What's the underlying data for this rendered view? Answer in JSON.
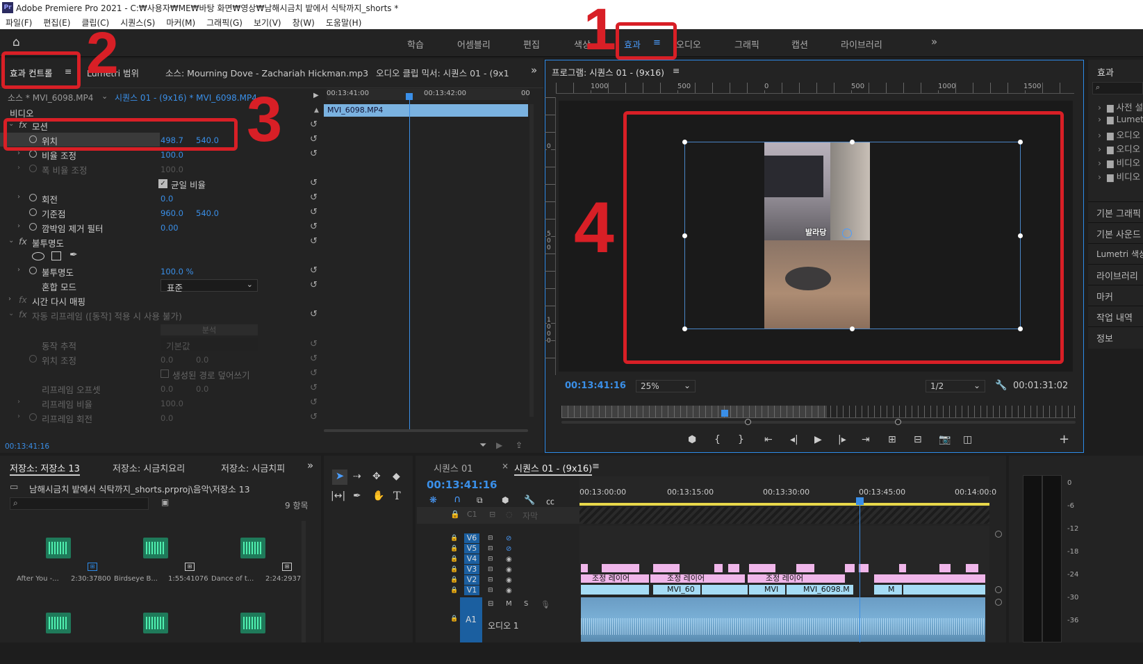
{
  "app": {
    "title": "Adobe Premiere Pro 2021 - C:₩사용자₩ME₩바탕 화면₩영상₩남해시금치 밭에서 식탁까지_shorts *",
    "logo": "Pr"
  },
  "menu": [
    "파일(F)",
    "편집(E)",
    "클립(C)",
    "시퀀스(S)",
    "마커(M)",
    "그래픽(G)",
    "보기(V)",
    "창(W)",
    "도움말(H)"
  ],
  "workspaces": [
    "학습",
    "어셈블리",
    "편집",
    "색상",
    "효과",
    "오디오",
    "그래픽",
    "캡션",
    "라이브러리"
  ],
  "workspace_active_menu": "≡",
  "workspace_more": "»",
  "left_panel": {
    "tabs": [
      "효과 컨트롤",
      "Lumetri 범위",
      "소스: Mourning Dove - Zachariah Hickman.mp3",
      "오디오 클립 믹서: 시퀀스 01 - (9x1"
    ],
    "tab_menu": "≡",
    "more": "»",
    "source": "소스 * MVI_6098.MP4",
    "sequence": "시퀀스 01 - (9x16) * MVI_6098.MP4",
    "section_video": "비디오",
    "tl_time1": "00:13:41:00",
    "tl_time2": "00:13:42:00",
    "tl_time3": "00",
    "clip_name": "MVI_6098.MP4",
    "motion": "모션",
    "position": {
      "label": "위치",
      "x": "498.7",
      "y": "540.0"
    },
    "scale": {
      "label": "비율 조정",
      "value": "100.0"
    },
    "scale_w": {
      "label": "폭 비율 조정",
      "value": "100.0"
    },
    "uniform": "균일 비율",
    "rotation": {
      "label": "회전",
      "value": "0.0"
    },
    "anchor": {
      "label": "기준점",
      "x": "960.0",
      "y": "540.0"
    },
    "antiflicker": {
      "label": "깜박임 제거 필터",
      "value": "0.00"
    },
    "opacity": "불투명도",
    "opacity_val": {
      "label": "불투명도",
      "value": "100.0 %"
    },
    "blend": {
      "label": "혼합 모드",
      "value": "표준"
    },
    "time_remap": "시간 다시 매핑",
    "auto_reframe": "자동 리프레임 ([동작] 적용 시 사용 불가)",
    "analyze": "분석",
    "motion_track": {
      "label": "동작 추적",
      "value": "기본값"
    },
    "pos_adjust": {
      "label": "위치 조정",
      "x": "0.0",
      "y": "0.0"
    },
    "overwrite": "생성된 경로 덮어쓰기",
    "reframe_offset": {
      "label": "리프레임 오프셋",
      "x": "0.0",
      "y": "0.0"
    },
    "reframe_scale": {
      "label": "리프레임 비율",
      "value": "100.0"
    },
    "reframe_rot": {
      "label": "리프레임 회전",
      "value": "0.0"
    },
    "timecode": "00:13:41:16"
  },
  "program": {
    "title": "프로그램: 시퀀스 01 - (9x16)",
    "menu": "≡",
    "ruler": [
      "1000",
      "500",
      "0",
      "500",
      "1000",
      "1500"
    ],
    "vruler": [
      "0",
      "5\n0\n0",
      "1\n0\n0\n0"
    ],
    "caption": "발라당",
    "timecode": "00:13:41:16",
    "zoom": "25%",
    "quality": "1/2",
    "duration": "00:01:31:02"
  },
  "effects_panel": {
    "title": "효과",
    "items": [
      "사전 설",
      "Lumet",
      "오디오",
      "오디오",
      "비디오",
      "비디오"
    ],
    "panels": [
      "기본 그래픽",
      "기본 사운드",
      "Lumetri 색상",
      "라이브러리",
      "마커",
      "작업 내역",
      "정보"
    ]
  },
  "project": {
    "tabs": [
      "저장소: 저장소 13",
      "저장소: 시금치요리",
      "저장소: 시금치피"
    ],
    "more": "»",
    "path": "남해시금치 밭에서 식탁까지_shorts.prproj\\음악\\저장소 13",
    "count": "9 항목",
    "bins": [
      {
        "name": "After You -...",
        "dur": "2:30:37800"
      },
      {
        "name": "Birdseye B...",
        "dur": "1:55:41076"
      },
      {
        "name": "Dance of t...",
        "dur": "2:24:29376"
      }
    ]
  },
  "timeline": {
    "tabs": [
      "시퀀스 01",
      "시퀀스 01 - (9x16)"
    ],
    "close": "×",
    "menu": "≡",
    "timecode": "00:13:41:16",
    "ruler": [
      "00:13:00:00",
      "00:13:15:00",
      "00:13:30:00",
      "00:13:45:00",
      "00:14:00:0"
    ],
    "caption_track": "C1",
    "caption_label": "자막",
    "video_tracks": [
      "V6",
      "V5",
      "V4",
      "V3",
      "V2",
      "V1"
    ],
    "audio_track": "A1",
    "audio_label": "오디오 1",
    "adj_label": "조정 레이어",
    "clip_labels": [
      "MVI_60",
      "MVI",
      "MVI_6098.M",
      "M"
    ],
    "meter": [
      "0",
      "-6",
      "-12",
      "-18",
      "-24",
      "-30",
      "-36"
    ]
  },
  "annotations": [
    "1",
    "2",
    "3",
    "4"
  ],
  "colors": {
    "accent": "#2d8ceb",
    "red": "#d81f26",
    "clip_pink": "#f0b6ea",
    "clip_blue": "#a6dcf5"
  }
}
